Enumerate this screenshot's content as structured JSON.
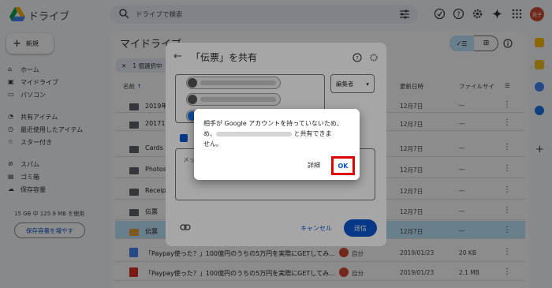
{
  "header": {
    "app_title": "ドライブ",
    "search_placeholder": "ドライブで検索",
    "avatar_text": "花子"
  },
  "sidebar": {
    "new_label": "新規",
    "items": [
      {
        "label": "ホーム"
      },
      {
        "label": "マイドライブ"
      },
      {
        "label": "パソコン"
      },
      {
        "label": "共有アイテム"
      },
      {
        "label": "最近使用したアイテム"
      },
      {
        "label": "スター付き"
      },
      {
        "label": "スパム"
      },
      {
        "label": "ゴミ箱"
      },
      {
        "label": "保存容量"
      }
    ],
    "storage_text": "15 GB 中 125.9 MB を使用",
    "storage_button": "保存容量を増やす"
  },
  "main": {
    "title": "マイドライブ",
    "selection_text": "1 個選択中",
    "columns": {
      "name": "名前",
      "date": "更新日時",
      "size": "ファイルサイ"
    },
    "rows": [
      {
        "name": "2019年1",
        "date": "12月7日",
        "size": "—"
      },
      {
        "name": "2017111",
        "date": "12月7日",
        "size": "—"
      },
      {
        "name": "Cards",
        "date": "12月7日",
        "size": "—"
      },
      {
        "name": "Photos",
        "date": "12月7日",
        "size": "—"
      },
      {
        "name": "Receipt",
        "date": "12月7日",
        "size": "—"
      },
      {
        "name": "伝票",
        "date": "12月7日",
        "size": "—"
      },
      {
        "name": "伝票",
        "date": "12月7日",
        "size": "—"
      },
      {
        "name": "「Paypay使った？」100億円のうちの5万円を実際にGETしてみ...",
        "owner": "自分",
        "date": "2019/01/23",
        "size": "20 KB"
      },
      {
        "name": "「Paypay使った？」100億円のうちの5万円を実際にGETしてみ...",
        "owner": "自分",
        "date": "2019/01/23",
        "size": "2.1 MB"
      }
    ]
  },
  "share_dialog": {
    "title": "「伝票」を共有",
    "role": "編集者",
    "message_placeholder": "メッ",
    "cancel_label": "キャンセル",
    "send_label": "送信"
  },
  "alert": {
    "line1": "相手が Google アカウントを持っていないため、",
    "line2_prefix": "め、",
    "line2_suffix": "と共有できま",
    "line3": "せん。",
    "detail_label": "詳細",
    "ok_label": "OK"
  },
  "colors": {
    "accent": "#0b57d0",
    "highlight": "#e00000",
    "selected_row": "#c2e7ff"
  }
}
